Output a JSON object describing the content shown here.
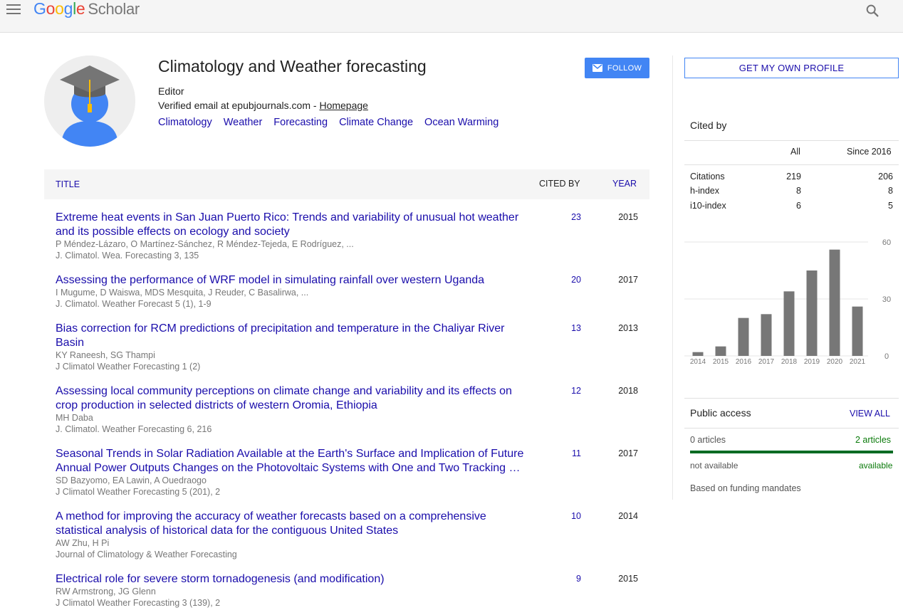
{
  "header": {
    "logo_google": [
      "G",
      "o",
      "o",
      "g",
      "l",
      "e"
    ],
    "logo_scholar": "Scholar",
    "colors": {
      "blue": "#4285f4",
      "red": "#ea4335",
      "yellow": "#fbbc05",
      "green": "#34a853"
    }
  },
  "profile": {
    "name": "Climatology and Weather forecasting",
    "affiliation": "Editor",
    "email_text": "Verified email at epubjournals.com - ",
    "homepage": "Homepage",
    "interests": [
      "Climatology",
      "Weather",
      "Forecasting",
      "Climate Change",
      "Ocean Warming"
    ],
    "follow_label": "FOLLOW"
  },
  "table": {
    "col_title": "TITLE",
    "col_cited": "CITED BY",
    "col_year": "YEAR",
    "rows": [
      {
        "title": "Extreme heat events in San Juan Puerto Rico: Trends and variability of unusual hot weather and its possible effects on ecology and society",
        "authors": "P Méndez-Lázaro, O Martínez-Sánchez, R Méndez-Tejeda, E Rodríguez, ...",
        "venue": "J. Climatol. Wea. Forecasting 3, 135",
        "cited": "23",
        "year": "2015"
      },
      {
        "title": "Assessing the performance of WRF model in simulating rainfall over western Uganda",
        "authors": "I Mugume, D Waiswa, MDS Mesquita, J Reuder, C Basalirwa, ...",
        "venue": "J. Climatol. Weather Forecast 5 (1), 1-9",
        "cited": "20",
        "year": "2017"
      },
      {
        "title": "Bias correction for RCM predictions of precipitation and temperature in the Chaliyar River Basin",
        "authors": "KY Raneesh, SG Thampi",
        "venue": "J Climatol Weather Forecasting 1 (2)",
        "cited": "13",
        "year": "2013"
      },
      {
        "title": "Assessing local community perceptions on climate change and variability and its effects on crop production in selected districts of western Oromia, Ethiopia",
        "authors": "MH Daba",
        "venue": "J. Climatol. Weather Forecasting 6, 216",
        "cited": "12",
        "year": "2018"
      },
      {
        "title": "Seasonal Trends in Solar Radiation Available at the Earth's Surface and Implication of Future Annual Power Outputs Changes on the Photovoltaic Systems with One and Two Tracking …",
        "authors": "SD Bazyomo, EA Lawin, A Ouedraogo",
        "venue": "J Climatol Weather Forecasting 5 (201), 2",
        "cited": "11",
        "year": "2017"
      },
      {
        "title": "A method for improving the accuracy of weather forecasts based on a comprehensive statistical analysis of historical data for the contiguous United States",
        "authors": "AW Zhu, H Pi",
        "venue": "Journal of Climatology & Weather Forecasting",
        "cited": "10",
        "year": "2014"
      },
      {
        "title": "Electrical role for severe storm tornadogenesis (and modification)",
        "authors": "RW Armstrong, JG Glenn",
        "venue": "J Climatol Weather Forecasting 3 (139), 2",
        "cited": "9",
        "year": "2015"
      }
    ]
  },
  "sidebar": {
    "own_profile_label": "GET MY OWN PROFILE",
    "cited_by_title": "Cited by",
    "col_all": "All",
    "col_since": "Since 2016",
    "stats": [
      {
        "label": "Citations",
        "all": "219",
        "since": "206"
      },
      {
        "label": "h-index",
        "all": "8",
        "since": "8"
      },
      {
        "label": "i10-index",
        "all": "6",
        "since": "5"
      }
    ],
    "public_access_title": "Public access",
    "view_all": "VIEW ALL",
    "pa_left_count": "0 articles",
    "pa_right_count": "2 articles",
    "pa_left_status": "not available",
    "pa_right_status": "available",
    "pa_note": "Based on funding mandates",
    "pa_available_fraction": 1.0
  },
  "chart_data": {
    "type": "bar",
    "categories": [
      "2014",
      "2015",
      "2016",
      "2017",
      "2018",
      "2019",
      "2020",
      "2021"
    ],
    "values": [
      2,
      5,
      20,
      22,
      34,
      45,
      56,
      26
    ],
    "ylim": [
      0,
      60
    ],
    "yticks": [
      0,
      30,
      60
    ],
    "color": "#777777",
    "grid": true
  }
}
